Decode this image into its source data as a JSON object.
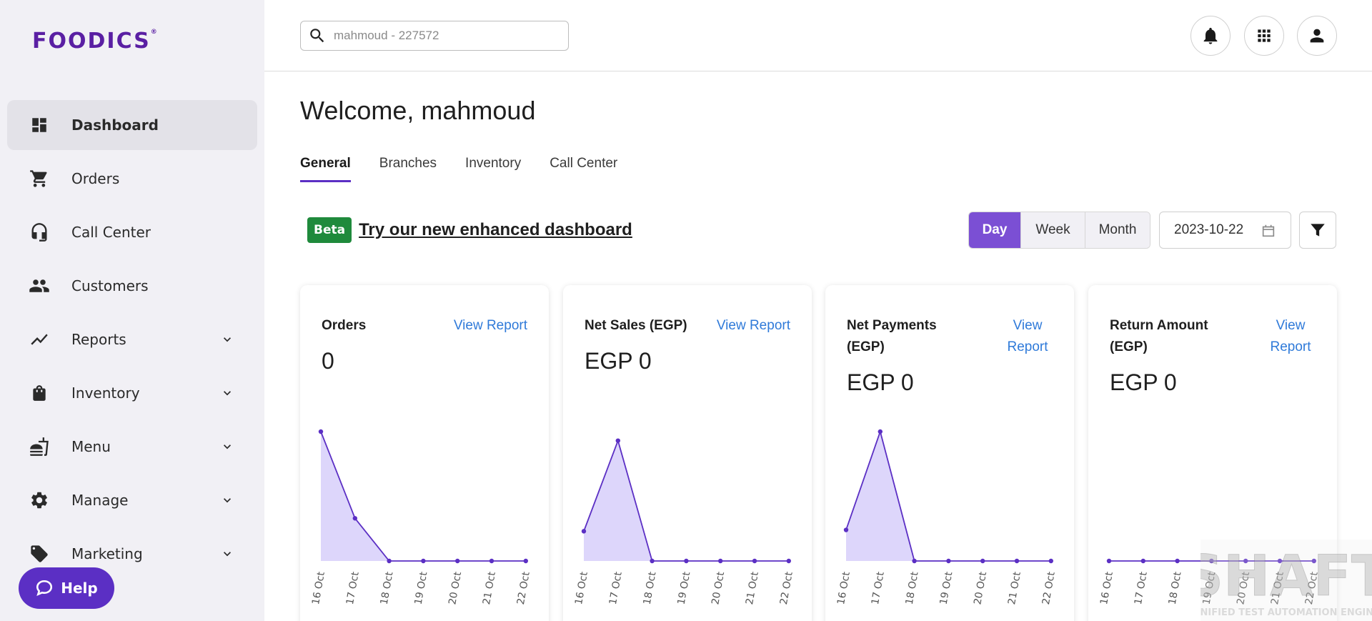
{
  "app": {
    "logo_text": "FOODICS",
    "brand_color": "#5a1fa3",
    "accent_color": "#5b2fc4"
  },
  "sidebar": {
    "items": [
      {
        "label": "Dashboard",
        "icon": "dashboard-icon",
        "active": true,
        "expandable": false
      },
      {
        "label": "Orders",
        "icon": "cart-icon",
        "active": false,
        "expandable": false
      },
      {
        "label": "Call Center",
        "icon": "headset-icon",
        "active": false,
        "expandable": false
      },
      {
        "label": "Customers",
        "icon": "people-icon",
        "active": false,
        "expandable": false
      },
      {
        "label": "Reports",
        "icon": "trending-icon",
        "active": false,
        "expandable": true
      },
      {
        "label": "Inventory",
        "icon": "bag-icon",
        "active": false,
        "expandable": true
      },
      {
        "label": "Menu",
        "icon": "food-icon",
        "active": false,
        "expandable": true
      },
      {
        "label": "Manage",
        "icon": "gear-icon",
        "active": false,
        "expandable": true
      },
      {
        "label": "Marketing",
        "icon": "tag-icon",
        "active": false,
        "expandable": true
      }
    ],
    "help_label": "Help"
  },
  "header": {
    "search_value": "mahmoud - 227572"
  },
  "main": {
    "welcome": "Welcome, mahmoud",
    "tabs": [
      "General",
      "Branches",
      "Inventory",
      "Call Center"
    ],
    "active_tab": "General",
    "beta_badge": "Beta",
    "beta_link": "Try our new enhanced dashboard",
    "periods": [
      "Day",
      "Week",
      "Month"
    ],
    "active_period": "Day",
    "date": "2023-10-22"
  },
  "cards": [
    {
      "title": "Orders",
      "link": "View Report",
      "value": "0"
    },
    {
      "title": "Net Sales (EGP)",
      "link": "View Report",
      "value": "EGP 0"
    },
    {
      "title": "Net Payments (EGP)",
      "link": "View Report",
      "value": "EGP 0"
    },
    {
      "title": "Return Amount (EGP)",
      "link": "View Report",
      "value": "EGP 0"
    }
  ],
  "chart_data": [
    {
      "type": "area",
      "categories": [
        "16 Oct",
        "17 Oct",
        "18 Oct",
        "19 Oct",
        "20 Oct",
        "21 Oct",
        "22 Oct"
      ],
      "values": [
        1.0,
        0.33,
        0,
        0,
        0,
        0,
        0
      ]
    },
    {
      "type": "area",
      "categories": [
        "16 Oct",
        "17 Oct",
        "18 Oct",
        "19 Oct",
        "20 Oct",
        "21 Oct",
        "22 Oct"
      ],
      "values": [
        0.23,
        0.93,
        0,
        0,
        0,
        0,
        0
      ]
    },
    {
      "type": "area",
      "categories": [
        "16 Oct",
        "17 Oct",
        "18 Oct",
        "19 Oct",
        "20 Oct",
        "21 Oct",
        "22 Oct"
      ],
      "values": [
        0.24,
        1.0,
        0,
        0,
        0,
        0,
        0
      ]
    },
    {
      "type": "area",
      "categories": [
        "16 Oct",
        "17 Oct",
        "18 Oct",
        "19 Oct",
        "20 Oct",
        "21 Oct",
        "22 Oct"
      ],
      "values": [
        0,
        0,
        0,
        0,
        0,
        0,
        0
      ]
    }
  ],
  "watermark": {
    "text": "SHAFT",
    "subtext": "UNIFIED TEST AUTOMATION ENGINE"
  }
}
